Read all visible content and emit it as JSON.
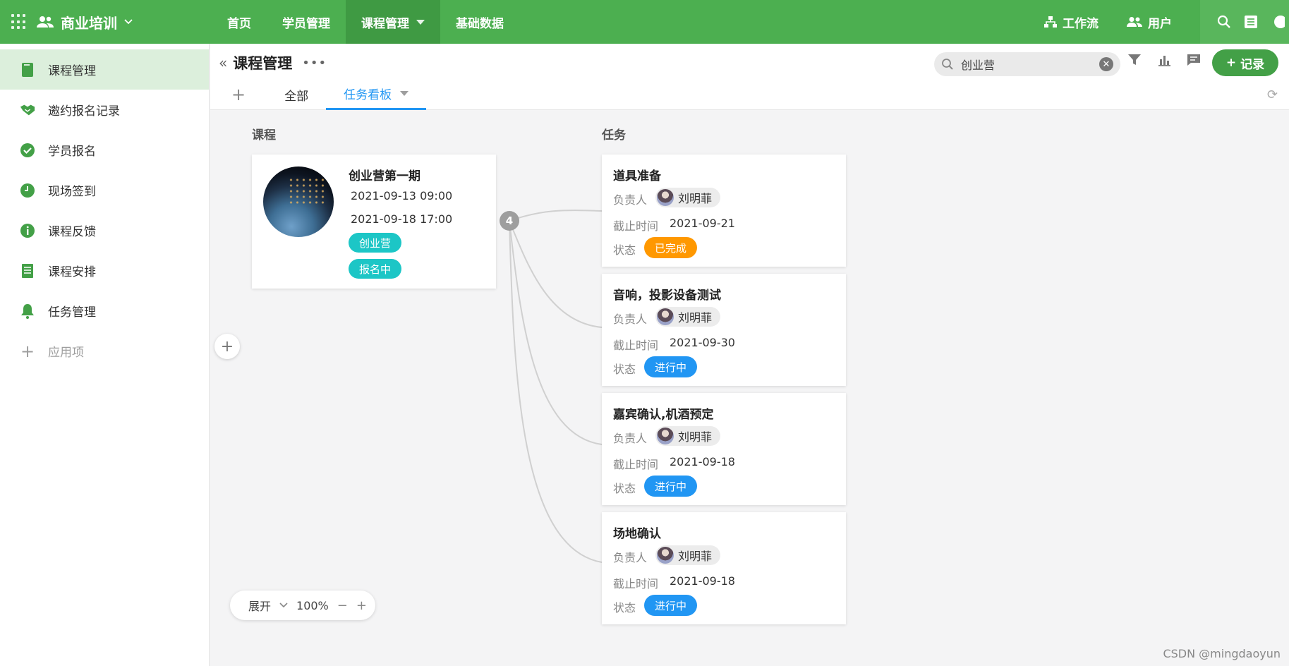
{
  "app": {
    "name": "商业培训"
  },
  "topnav": [
    {
      "label": "首页",
      "active": false
    },
    {
      "label": "学员管理",
      "active": false
    },
    {
      "label": "课程管理",
      "active": true
    },
    {
      "label": "基础数据",
      "active": false
    }
  ],
  "topright": {
    "workflow": "工作流",
    "users": "用户"
  },
  "sidebar": {
    "items": [
      {
        "label": "课程管理",
        "icon": "book-icon",
        "active": true
      },
      {
        "label": "邀约报名记录",
        "icon": "handshake-icon",
        "active": false
      },
      {
        "label": "学员报名",
        "icon": "check-circle-icon",
        "active": false
      },
      {
        "label": "现场签到",
        "icon": "clock-icon",
        "active": false
      },
      {
        "label": "课程反馈",
        "icon": "info-icon",
        "active": false
      },
      {
        "label": "课程安排",
        "icon": "list-doc-icon",
        "active": false
      },
      {
        "label": "任务管理",
        "icon": "bell-icon",
        "active": false
      }
    ],
    "add_label": "应用项"
  },
  "header": {
    "title": "课程管理",
    "tabs": {
      "all": "全部",
      "board": "任务看板"
    },
    "search_value": "创业营",
    "record_button": "记录"
  },
  "board": {
    "course_label": "课程",
    "task_label": "任务",
    "course": {
      "title": "创业营第一期",
      "start": "2021-09-13 09:00",
      "end": "2021-09-18 17:00",
      "tags": [
        "创业营",
        "报名中"
      ]
    },
    "task_count": "4",
    "field_labels": {
      "owner": "负责人",
      "due": "截止时间",
      "status": "状态"
    },
    "tasks": [
      {
        "title": "道具准备",
        "owner": "刘明菲",
        "due": "2021-09-21",
        "status": "已完成",
        "status_color": "#ff9800"
      },
      {
        "title": "音响，投影设备测试",
        "owner": "刘明菲",
        "due": "2021-09-30",
        "status": "进行中",
        "status_color": "#2196f3"
      },
      {
        "title": "嘉宾确认,机酒预定",
        "owner": "刘明菲",
        "due": "2021-09-18",
        "status": "进行中",
        "status_color": "#2196f3"
      },
      {
        "title": "场地确认",
        "owner": "刘明菲",
        "due": "2021-09-18",
        "status": "进行中",
        "status_color": "#2196f3"
      }
    ],
    "zoom": {
      "expand_label": "展开",
      "level": "100%"
    }
  },
  "colors": {
    "primary": "#4caf50",
    "accent_blue": "#2196f3",
    "tag_teal": "#1cc6c6",
    "done_orange": "#ff9800"
  },
  "watermark": "CSDN @mingdaoyun"
}
